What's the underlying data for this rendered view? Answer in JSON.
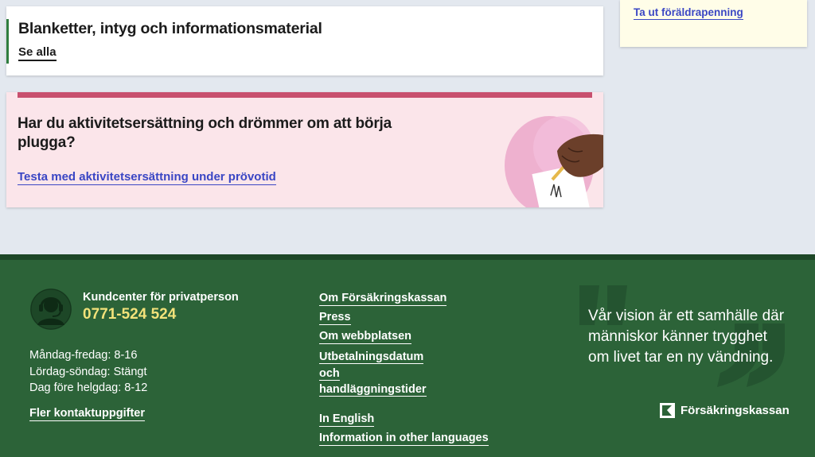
{
  "forms_card": {
    "title": "Blanketter, intyg och informationsmaterial",
    "link": "Se alla"
  },
  "right_card": {
    "link": "Ta ut föräldrapenning"
  },
  "promo": {
    "heading": "Har du aktivitetsersättning och drömmer om att börja plugga?",
    "link": "Testa med aktivitetsersättning under prövotid"
  },
  "footer": {
    "customer_center": {
      "icon": "headset-icon",
      "title": "Kundcenter för privatperson",
      "phone": "0771-524 524",
      "hours": [
        "Måndag-fredag: 8-16",
        "Lördag-söndag: Stängt",
        "Dag före helgdag: 8-12"
      ],
      "more_link": "Fler kontaktuppgifter"
    },
    "links": {
      "about": "Om Försäkringskassan",
      "press": "Press",
      "about_site": "Om webbplatsen",
      "payout": "Utbetalningsdatum och handläggningstider",
      "english": "In English",
      "other_languages": "Information in other languages"
    },
    "vision": "Vår vision är ett samhälle där människor känner trygghet om livet tar en ny vändning.",
    "brand": "Försäkringskassan"
  },
  "colors": {
    "page_bg": "#e3e8ef",
    "footer_bg": "#2c6338",
    "link_blue": "#3a46c4",
    "phone_yellow": "#f2e27a",
    "promo_bg": "#fbe5ea",
    "promo_accent": "#c8506e"
  }
}
